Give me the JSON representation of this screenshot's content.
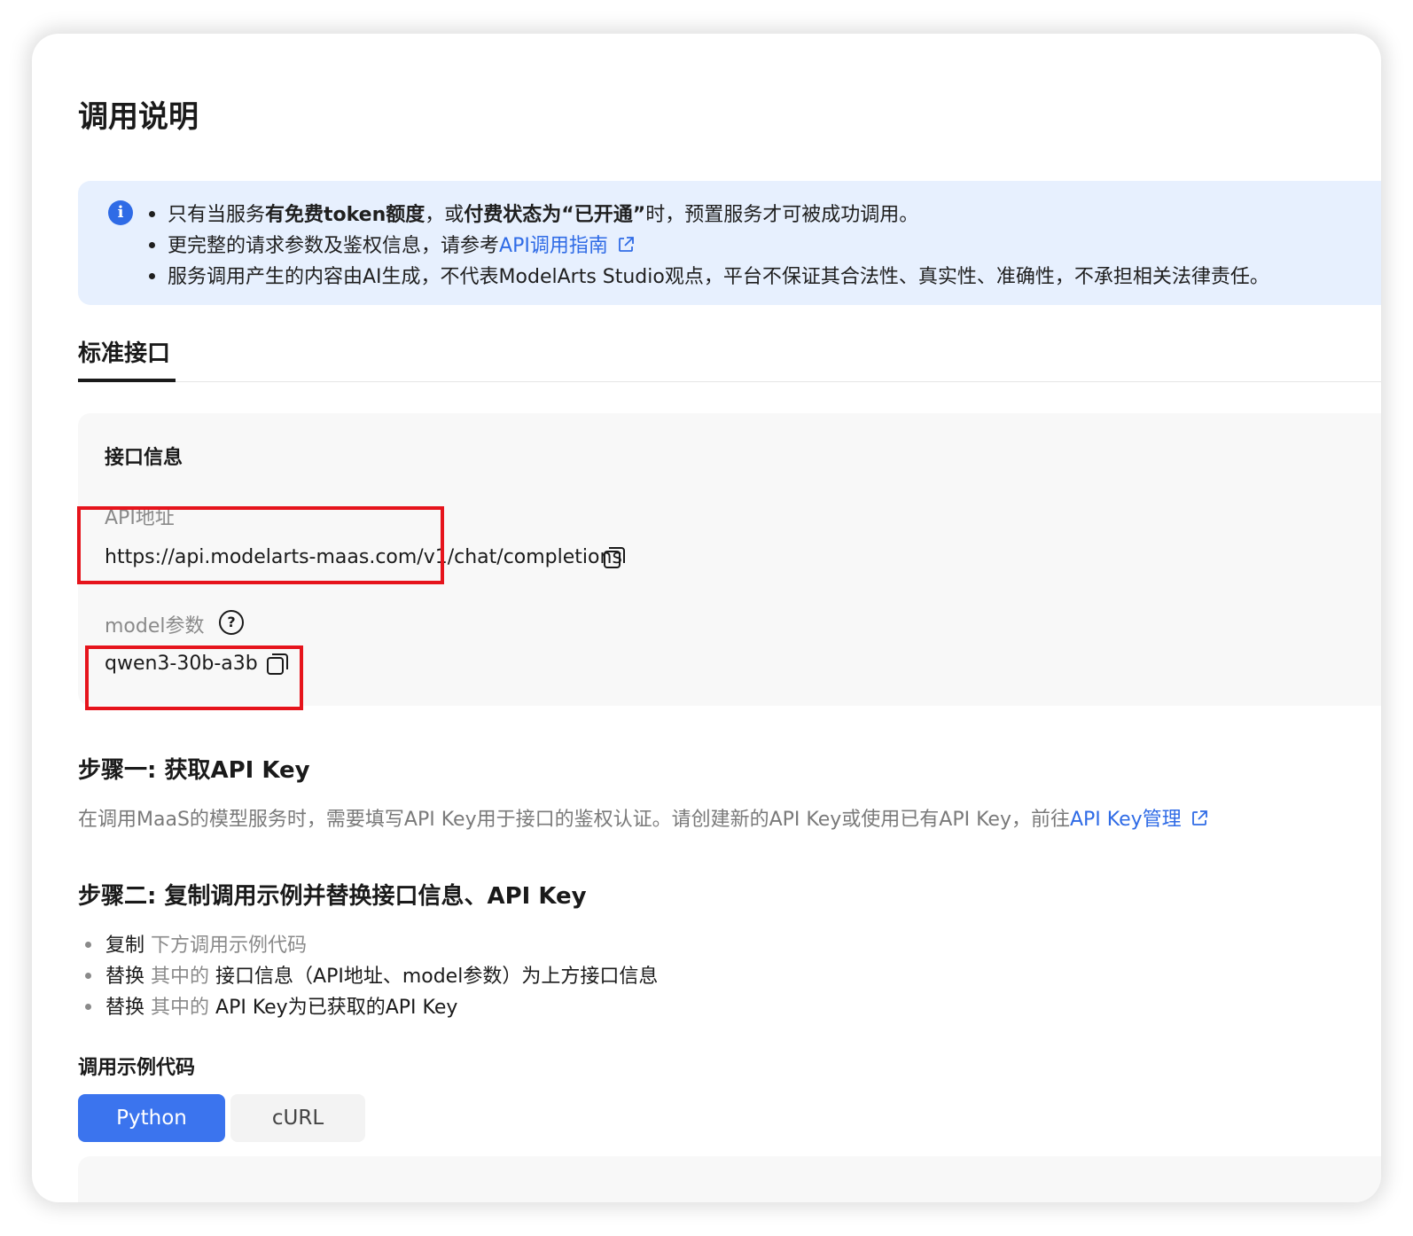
{
  "page_title": "调用说明",
  "notice": {
    "line1_pre": "只有当服务",
    "line1_bold1": "有免费token额度",
    "line1_mid": "，或",
    "line1_bold2": "付费状态为“已开通”",
    "line1_post": "时，预置服务才可被成功调用。",
    "line2_pre": "更完整的请求参数及鉴权信息，请参考",
    "line2_link": "API调用指南",
    "line3": "服务调用产生的内容由AI生成，不代表ModelArts Studio观点，平台不保证其合法性、真实性、准确性，不承担相关法律责任。"
  },
  "tab_label": "标准接口",
  "interface_info": {
    "title": "接口信息",
    "api_label": "API地址",
    "api_url": "https://api.modelarts-maas.com/v1/chat/completions",
    "model_label": "model参数",
    "help_glyph": "?",
    "model_value": "qwen3-30b-a3b"
  },
  "step1": {
    "title": "步骤一: 获取API Key",
    "desc": "在调用MaaS的模型服务时，需要填写API Key用于接口的鉴权认证。请创建新的API Key或使用已有API Key，前往",
    "link": "API Key管理"
  },
  "step2": {
    "title": "步骤二: 复制调用示例并替换接口信息、API Key",
    "b1_action": "复制",
    "b1_rest": " 下方调用示例代码",
    "b2_action": "替换",
    "b2_mid": " 其中的 ",
    "b2_rest": "接口信息（API地址、model参数）为上方接口信息",
    "b3_action": "替换",
    "b3_mid": " 其中的 ",
    "b3_rest": "API Key为已获取的API Key"
  },
  "sample_code": {
    "title": "调用示例代码",
    "tabs": [
      "Python",
      "cURL"
    ]
  },
  "colors": {
    "accent": "#2f6be6",
    "notice_bg": "#e7f0fe",
    "highlight_box": "#e6141c",
    "active_tab": "#3b74ee"
  }
}
